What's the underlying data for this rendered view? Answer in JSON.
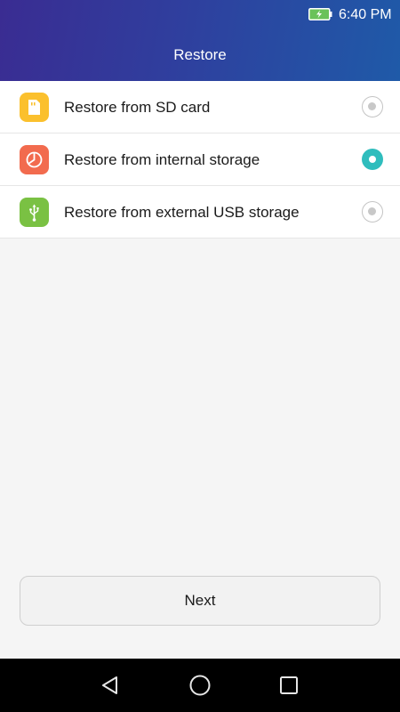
{
  "status_bar": {
    "time": "6:40 PM",
    "battery_icon": "battery-charging-icon",
    "battery_color": "#6ac259"
  },
  "header": {
    "title": "Restore"
  },
  "options": [
    {
      "label": "Restore from SD card",
      "icon": "sd-card-icon",
      "icon_color": "#fbc02d",
      "selected": false
    },
    {
      "label": "Restore from internal storage",
      "icon": "pie-chart-icon",
      "icon_color": "#f26b4e",
      "selected": true
    },
    {
      "label": "Restore from external USB storage",
      "icon": "usb-icon",
      "icon_color": "#7ac143",
      "selected": false
    }
  ],
  "next_button": {
    "label": "Next"
  },
  "nav_bar": {
    "back_icon": "back-triangle-icon",
    "home_icon": "home-circle-icon",
    "recents_icon": "recents-square-icon"
  },
  "colors": {
    "accent": "#2fbdbd",
    "header_start": "#3a2c92",
    "header_end": "#1f5aa8"
  }
}
